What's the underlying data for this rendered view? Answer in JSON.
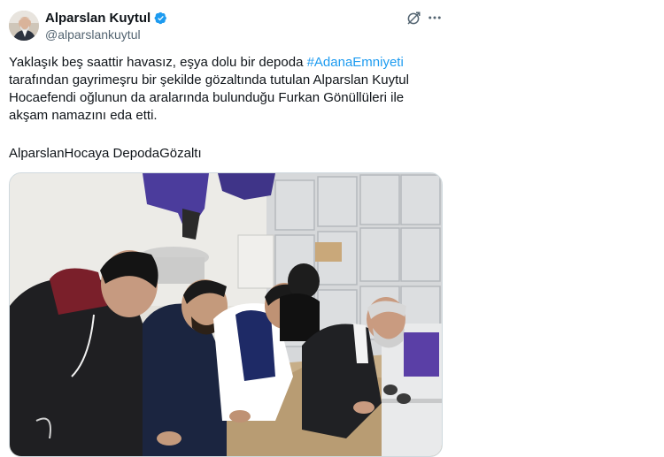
{
  "author": {
    "display_name": "Alparslan Kuytul",
    "handle": "@alparslankuytul",
    "verified": true
  },
  "icons": {
    "verified": "verified-badge-icon",
    "grok": "grok-icon",
    "more": "more-options-icon"
  },
  "colors": {
    "hashtag": "#1d9bf0",
    "verified": "#1d9bf0",
    "secondary_text": "#536471"
  },
  "tweet": {
    "text_part1": "Yaklaşık beş saattir havasız, eşya dolu bir depoda ",
    "hashtag": "#AdanaEmniyeti",
    "text_part2": " tarafından gayrimeşru bir şekilde gözaltında tutulan Alparslan Kuytul Hocaefendi oğlunun da aralarında bulunduğu Furkan Gönüllüleri ile akşam namazını eda etti.",
    "tag_line": "AlparslanHocaya DepodaGözaltı"
  }
}
